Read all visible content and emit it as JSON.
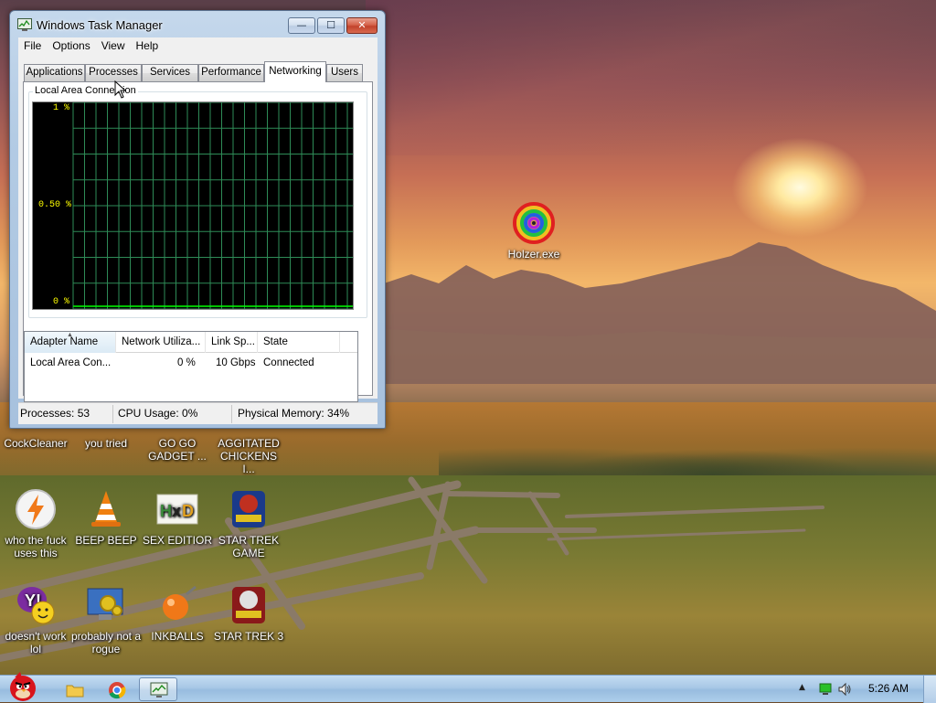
{
  "window": {
    "title": "Windows Task Manager",
    "controls": {
      "minimize": "—",
      "maximize": "☐",
      "close": "✕"
    },
    "menu": [
      "File",
      "Options",
      "View",
      "Help"
    ],
    "tabs": [
      "Applications",
      "Processes",
      "Services",
      "Performance",
      "Networking",
      "Users"
    ],
    "active_tab": "Networking",
    "graph": {
      "title": "Local Area Connection",
      "y_labels": {
        "top": "1 %",
        "mid": "0.50 %",
        "bottom": "0 %"
      },
      "grid_color": "#2e8b57",
      "line_color": "#00ff00"
    },
    "adapters": {
      "columns": [
        "Adapter Name",
        "Network Utiliza...",
        "Link Sp...",
        "State"
      ],
      "rows": [
        {
          "name": "Local Area Con...",
          "utilization": "0 %",
          "speed": "10 Gbps",
          "state": "Connected"
        }
      ]
    },
    "status": {
      "processes": "Processes: 53",
      "cpu": "CPU Usage: 0%",
      "memory": "Physical Memory: 34%"
    }
  },
  "desktop_icons": [
    {
      "label": "Holzer.exe",
      "icon": "rainbow-spiral-icon"
    },
    {
      "label": "CockCleaner",
      "icon": "cleaner-icon"
    },
    {
      "label": "you tried",
      "icon": "app-icon"
    },
    {
      "label": "GO GO GADGET ...",
      "icon": "app-icon"
    },
    {
      "label": "AGGITATED CHICKENS I...",
      "icon": "app-icon"
    },
    {
      "label": "who the fuck uses this",
      "icon": "lightning-icon"
    },
    {
      "label": "BEEP BEEP",
      "icon": "vlc-cone-icon"
    },
    {
      "label": "SEX EDITIOR",
      "icon": "hxd-icon"
    },
    {
      "label": "STAR TREK GAME",
      "icon": "star-wars-icon"
    },
    {
      "label": "doesn't work lol",
      "icon": "yahoo-messenger-icon"
    },
    {
      "label": "probably not a rogue",
      "icon": "gears-monitor-icon"
    },
    {
      "label": "INKBALLS",
      "icon": "inkball-icon"
    },
    {
      "label": "STAR TREK 3",
      "icon": "star-wars-icon"
    }
  ],
  "taskbar": {
    "clock": "5:26 AM",
    "items": [
      "angry-bird-start-icon",
      "explorer-folder-icon",
      "chrome-icon",
      "task-manager-icon"
    ],
    "tray": [
      "show-hidden-icons-arrow",
      "network-icon",
      "volume-icon"
    ]
  }
}
